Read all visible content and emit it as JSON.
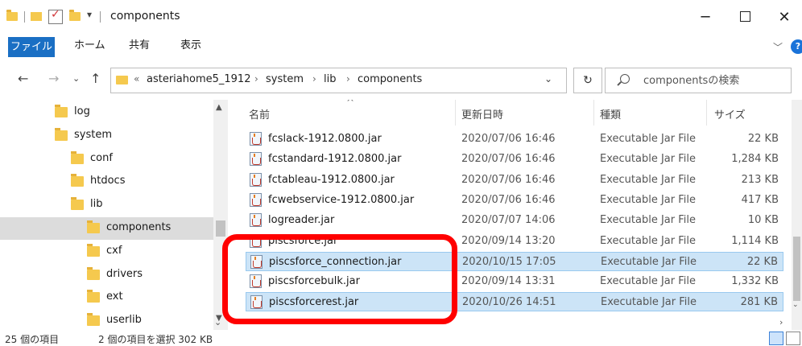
{
  "window": {
    "title": "components",
    "minimize_icon": "minimize-icon",
    "maximize_icon": "maximize-icon",
    "close_icon": "close-icon"
  },
  "ribbon": {
    "tabs": [
      "ファイル",
      "ホーム",
      "共有",
      "表示"
    ]
  },
  "address": {
    "prefix": "«",
    "crumbs": [
      "asteriahome5_1912",
      "system",
      "lib",
      "components"
    ]
  },
  "search": {
    "placeholder": "componentsの検索"
  },
  "tree": {
    "items": [
      {
        "label": "log",
        "indent": 0
      },
      {
        "label": "system",
        "indent": 0
      },
      {
        "label": "conf",
        "indent": 1
      },
      {
        "label": "htdocs",
        "indent": 1
      },
      {
        "label": "lib",
        "indent": 1
      },
      {
        "label": "components",
        "indent": 2,
        "selected": true
      },
      {
        "label": "cxf",
        "indent": 2
      },
      {
        "label": "drivers",
        "indent": 2
      },
      {
        "label": "ext",
        "indent": 2
      },
      {
        "label": "userlib",
        "indent": 2
      }
    ]
  },
  "columns": {
    "name": "名前",
    "date": "更新日時",
    "type": "種類",
    "size": "サイズ"
  },
  "files": [
    {
      "name": "fcslack-1912.0800.jar",
      "date": "2020/07/06 16:46",
      "type": "Executable Jar File",
      "size": "22 KB",
      "selected": false
    },
    {
      "name": "fcstandard-1912.0800.jar",
      "date": "2020/07/06 16:46",
      "type": "Executable Jar File",
      "size": "1,284 KB",
      "selected": false
    },
    {
      "name": "fctableau-1912.0800.jar",
      "date": "2020/07/06 16:46",
      "type": "Executable Jar File",
      "size": "213 KB",
      "selected": false
    },
    {
      "name": "fcwebservice-1912.0800.jar",
      "date": "2020/07/06 16:46",
      "type": "Executable Jar File",
      "size": "417 KB",
      "selected": false
    },
    {
      "name": "logreader.jar",
      "date": "2020/07/07 14:06",
      "type": "Executable Jar File",
      "size": "10 KB",
      "selected": false
    },
    {
      "name": "piscsforce.jar",
      "date": "2020/09/14 13:20",
      "type": "Executable Jar File",
      "size": "1,114 KB",
      "selected": false
    },
    {
      "name": "piscsforce_connection.jar",
      "date": "2020/10/15 17:05",
      "type": "Executable Jar File",
      "size": "22 KB",
      "selected": true
    },
    {
      "name": "piscsforcebulk.jar",
      "date": "2020/09/14 13:31",
      "type": "Executable Jar File",
      "size": "1,332 KB",
      "selected": false
    },
    {
      "name": "piscsforcerest.jar",
      "date": "2020/10/26 14:51",
      "type": "Executable Jar File",
      "size": "281 KB",
      "selected": true
    }
  ],
  "status": {
    "item_count": "25 個の項目",
    "selection": "2 個の項目を選択  302 KB"
  },
  "colors": {
    "file_tab": "#1a6fc4",
    "selected_row": "#cce4f7",
    "folder": "#f5c94e",
    "highlight": "#ff0000"
  }
}
